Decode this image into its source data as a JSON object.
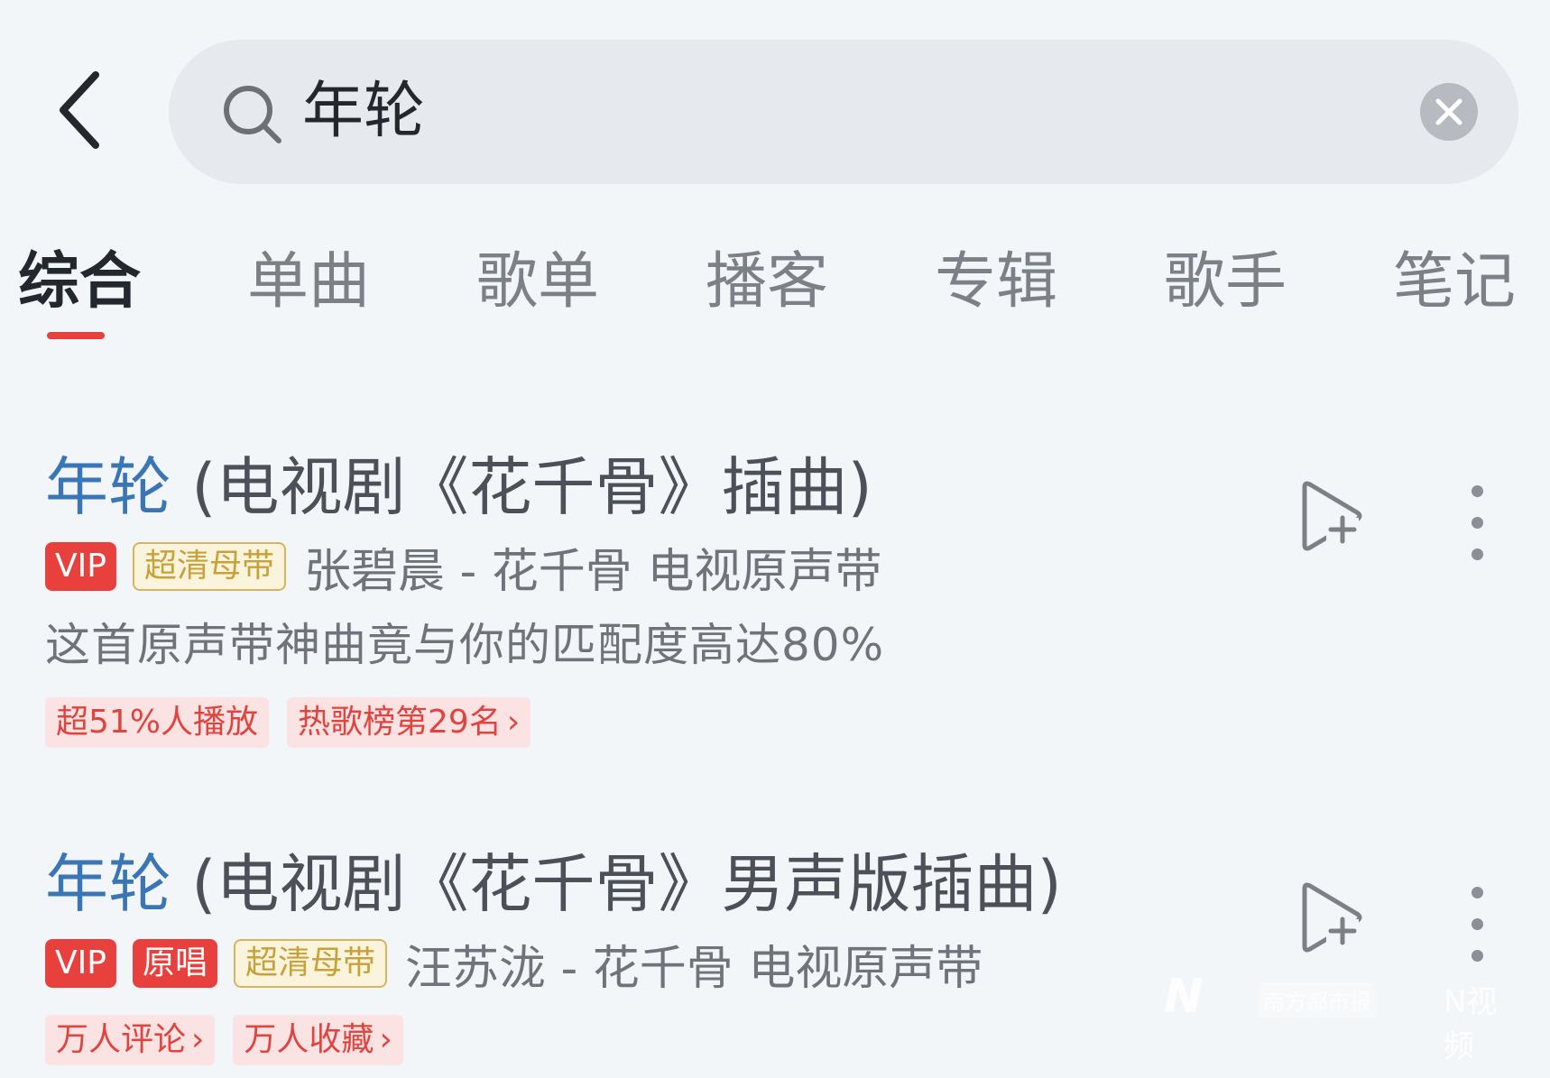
{
  "header": {
    "back_icon": "chevron-left-icon",
    "search": {
      "query": "年轮",
      "icon": "search-icon",
      "clear_icon": "close-icon"
    }
  },
  "tabs": [
    {
      "label": "综合",
      "active": true
    },
    {
      "label": "单曲",
      "active": false
    },
    {
      "label": "歌单",
      "active": false
    },
    {
      "label": "播客",
      "active": false
    },
    {
      "label": "专辑",
      "active": false
    },
    {
      "label": "歌手",
      "active": false
    },
    {
      "label": "笔记",
      "active": false
    }
  ],
  "results": [
    {
      "title_highlight": "年轮",
      "title_rest": " (电视剧《花千骨》插曲)",
      "badges": [
        "VIP",
        "超清母带"
      ],
      "artist_album": "张碧晨 - 花千骨 电视原声带",
      "description": "这首原声带神曲竟与你的匹配度高达80%",
      "tags": [
        "超51%人播放",
        "热歌榜第29名"
      ],
      "tag_chevron": [
        false,
        true
      ]
    },
    {
      "title_highlight": "年轮",
      "title_rest": " (电视剧《花千骨》男声版插曲)",
      "badges": [
        "VIP",
        "原唱",
        "超清母带"
      ],
      "artist_album": "汪苏泷 - 花千骨 电视原声带",
      "tags": [
        "万人评论",
        "万人收藏"
      ],
      "tag_chevron": [
        true,
        true
      ]
    }
  ],
  "watermark": {
    "logo": "N",
    "text1": "南方都市报",
    "text2": "N视频"
  },
  "colors": {
    "accent": "#e8413d",
    "highlight": "#3a76b5",
    "gold": "#c9a13a"
  }
}
